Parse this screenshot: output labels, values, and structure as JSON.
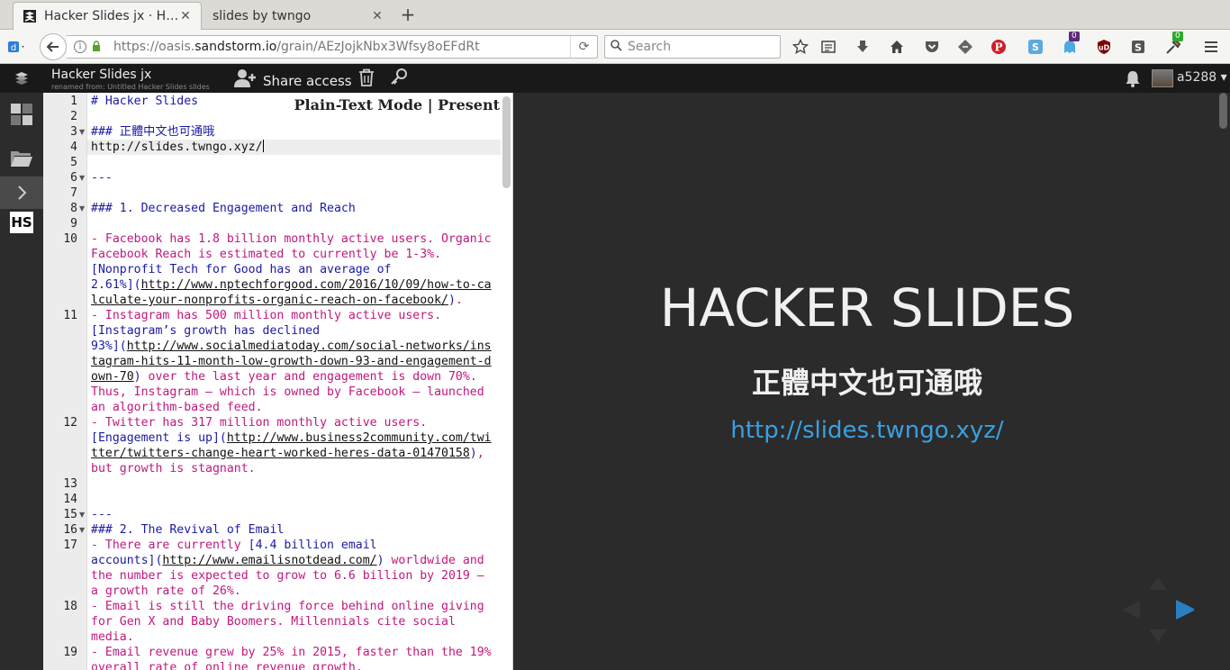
{
  "browser": {
    "tabs": [
      {
        "title": "Hacker Slides jx · Ha…",
        "active": true
      },
      {
        "title": "slides by twngo",
        "active": false
      }
    ],
    "url": {
      "prefix": "https://oasis.",
      "host": "sandstorm.io",
      "path": "/grain/AEzJojkNbx3Wfsy8oEFdRt"
    },
    "search_placeholder": "Search",
    "badges": {
      "ghostery": "0",
      "extension_green": "0"
    }
  },
  "sandstorm": {
    "grain_title": "Hacker Slides jx",
    "grain_subtitle": "renamed from: Untitled Hacker Slides slides",
    "share_label": "Share access",
    "username": "a5288 ▾",
    "sidebar_app_label": "HS"
  },
  "editor": {
    "mode_links": "Plain-Text Mode | Present",
    "line_numbers": [
      "1",
      "2",
      "3",
      "4",
      "5",
      "6",
      "7",
      "8",
      "9",
      "10",
      "11",
      "12",
      "13",
      "14",
      "15",
      "16",
      "17",
      "18",
      "19"
    ],
    "lines": {
      "l1": "# Hacker Slides",
      "l3": "### 正體中文也可通哦",
      "l4": "http://slides.twngo.xyz/",
      "l6": "---",
      "l8": "### 1. Decreased Engagement and Reach",
      "l10a": "- Facebook has 1.8 billion monthly active users. Organic",
      "l10b": "Facebook Reach is estimated to currently be 1-3%.",
      "l10c_bl": "[Nonprofit Tech for Good has an average of",
      "l10d_bl": "2.61%](",
      "l10d_link": "http://www.nptechforgood.com/2016/10/09/how-to-ca",
      "l10e_link": "lculate-your-nonprofits-organic-reach-on-facebook/",
      "l10e_bl": ")",
      "l10e_tail": ".",
      "l11a": "- Instagram has 500 million monthly active users.",
      "l11b_bl": "[Instagram’s growth has declined",
      "l11c_bl": "93%](",
      "l11c_link": "http://www.socialmediatoday.com/social-networks/ins",
      "l11d_link": "tagram-hits-11-month-low-growth-down-93-and-engagement-d",
      "l11e_link": "own-70",
      "l11e_bl": ")",
      "l11e_tail": " over the last year and engagement is down 70%.",
      "l11f": "Thus, Instagram – which is owned by Facebook – launched",
      "l11g": "an algorithm-based feed.",
      "l12a": "- Twitter has 317 million monthly active users.",
      "l12b_bl": "[Engagement is up](",
      "l12b_link": "http://www.business2community.com/twi",
      "l12c_link": "tter/twitters-change-heart-worked-heres-data-01470158",
      "l12c_bl": ")",
      "l12c_tail": ",",
      "l12d": "but growth is stagnant.",
      "l15": "---",
      "l16": "### 2. The Revival of Email",
      "l17a": "- There are currently ",
      "l17a_bl": "[4.4 billion email",
      "l17b_bl": "accounts](",
      "l17b_link": "http://www.emailisnotdead.com/",
      "l17b_bl2": ")",
      "l17b_tail": " worldwide and",
      "l17c": "the number is expected to grow to 6.6 billion by 2019 –",
      "l17d": "a growth rate of 26%.",
      "l18a": "- Email is still the driving force behind online giving",
      "l18b": "for Gen X and Baby Boomers. Millennials cite social",
      "l18c": "media.",
      "l19a": "- Email revenue grew by 25% in 2015, faster than the 19%",
      "l19b": "overall rate of online revenue growth."
    }
  },
  "preview": {
    "title": "HACKER SLIDES",
    "subtitle": "正體中文也可通哦",
    "link": "http://slides.twngo.xyz/"
  },
  "colors": {
    "heading": "#1a1aa6",
    "list": "#c0187d",
    "preview_bg": "#2b2b2b",
    "preview_link": "#3aa0e0",
    "nav_arrow": "#2a7fc0"
  }
}
